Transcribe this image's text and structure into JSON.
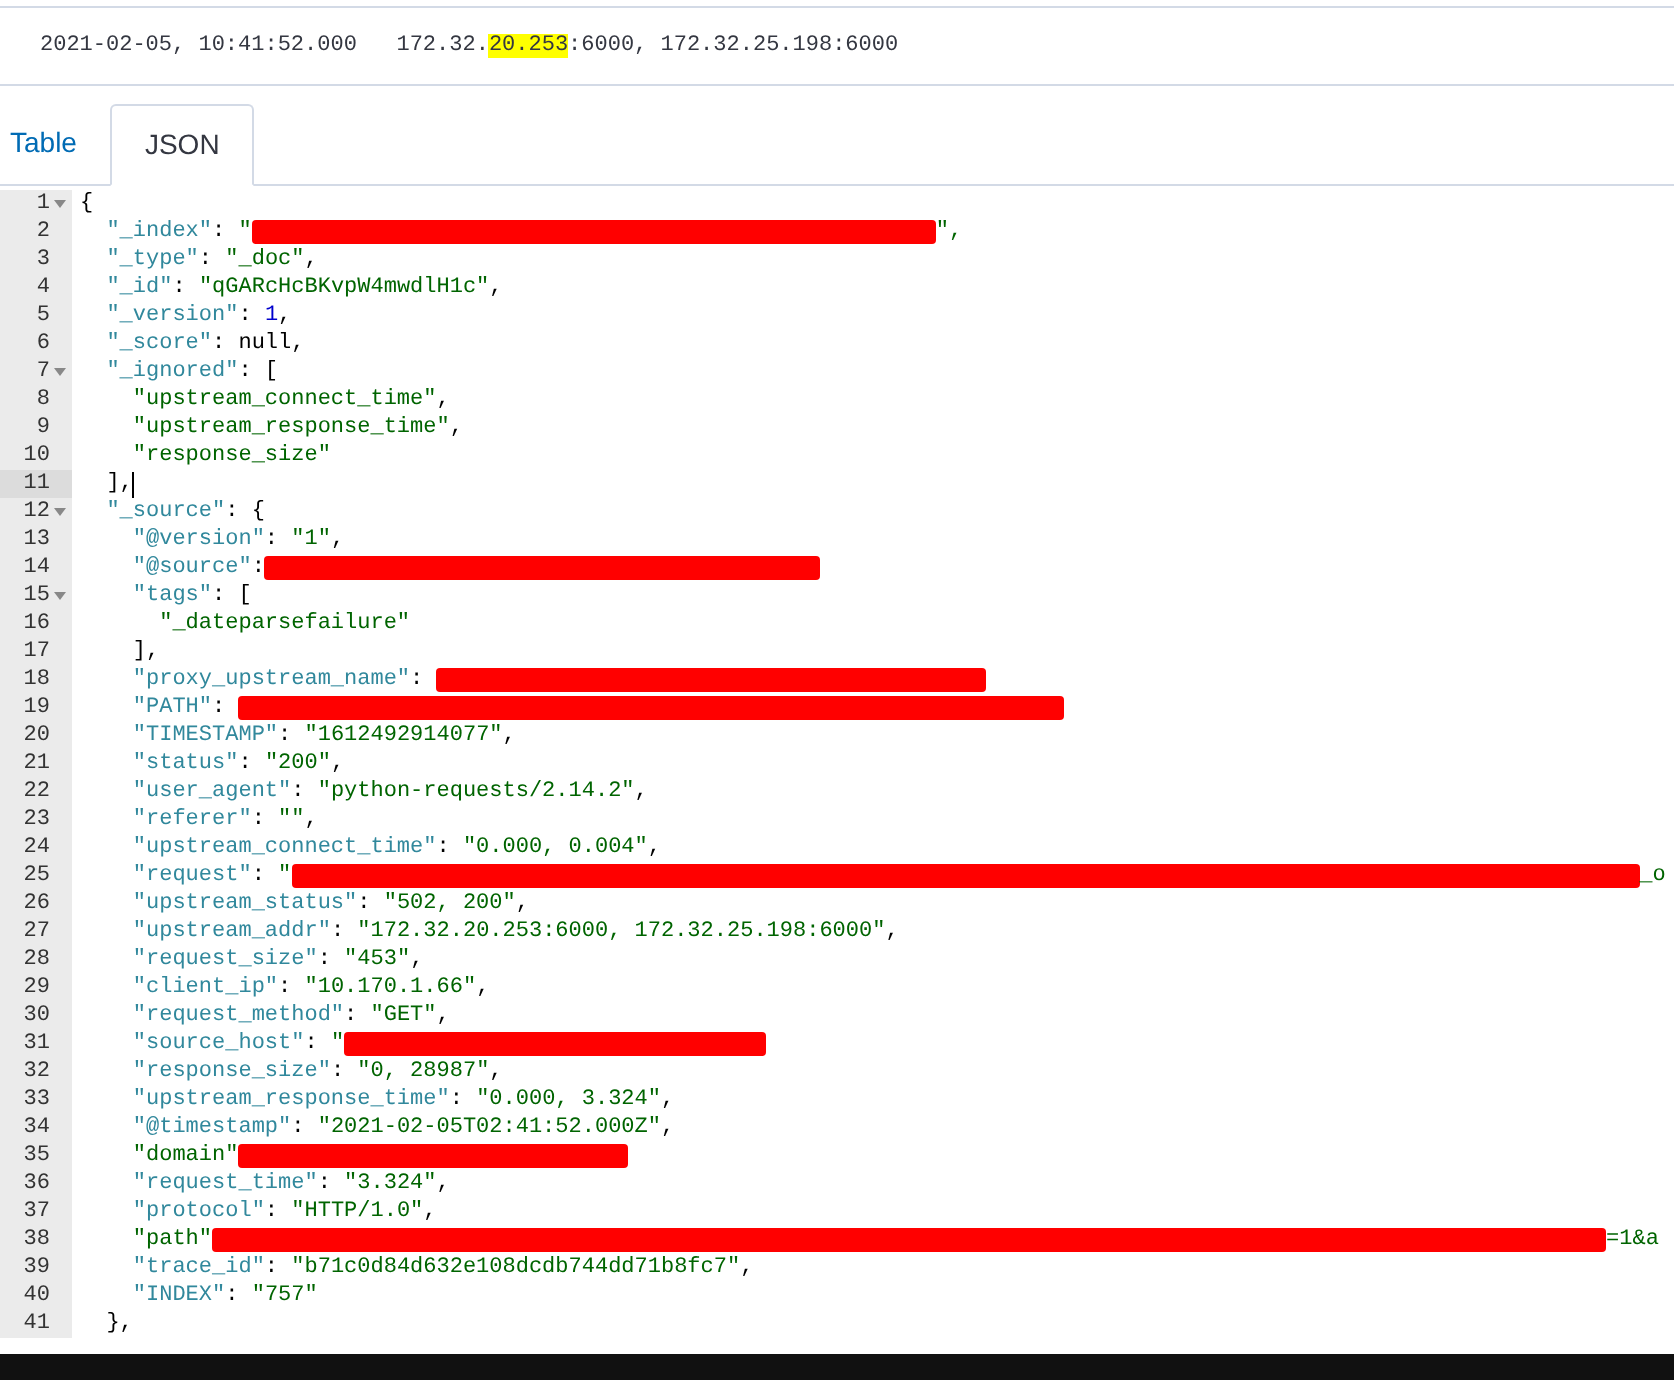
{
  "summary": {
    "timestamp": "2021-02-05, 10:41:52.000",
    "address_before": "172.32.",
    "address_highlight": "20.253",
    "address_after": ":6000, 172.32.25.198:6000"
  },
  "tabs": [
    {
      "label": "Table",
      "selected": false
    },
    {
      "label": "JSON",
      "selected": true
    }
  ],
  "editor": {
    "lines": [
      {
        "number": "1",
        "text": "{",
        "foldable": true,
        "active": false,
        "redacted": false
      },
      {
        "number": "2",
        "text": "  \"_index\": \"",
        "foldable": false,
        "active": false,
        "redacted": true,
        "tail": "\","
      },
      {
        "number": "3",
        "text": "  \"_type\": \"_doc\",",
        "foldable": false,
        "active": false,
        "redacted": false
      },
      {
        "number": "4",
        "text": "  \"_id\": \"qGARcHcBKvpW4mwdlH1c\",",
        "foldable": false,
        "active": false,
        "redacted": false
      },
      {
        "number": "5",
        "text": "  \"_version\": 1,",
        "foldable": false,
        "active": false,
        "redacted": false
      },
      {
        "number": "6",
        "text": "  \"_score\": null,",
        "foldable": false,
        "active": false,
        "redacted": false
      },
      {
        "number": "7",
        "text": "  \"_ignored\": [",
        "foldable": true,
        "active": false,
        "redacted": false
      },
      {
        "number": "8",
        "text": "    \"upstream_connect_time\",",
        "foldable": false,
        "active": false,
        "redacted": false
      },
      {
        "number": "9",
        "text": "    \"upstream_response_time\",",
        "foldable": false,
        "active": false,
        "redacted": false
      },
      {
        "number": "10",
        "text": "    \"response_size\"",
        "foldable": false,
        "active": false,
        "redacted": false
      },
      {
        "number": "11",
        "text": "  ],",
        "foldable": false,
        "active": true,
        "redacted": false
      },
      {
        "number": "12",
        "text": "  \"_source\": {",
        "foldable": true,
        "active": false,
        "redacted": false
      },
      {
        "number": "13",
        "text": "    \"@version\": \"1\",",
        "foldable": false,
        "active": false,
        "redacted": false
      },
      {
        "number": "14",
        "text": "    \"@source\":",
        "foldable": false,
        "active": false,
        "redacted": true
      },
      {
        "number": "15",
        "text": "    \"tags\": [",
        "foldable": true,
        "active": false,
        "redacted": false
      },
      {
        "number": "16",
        "text": "      \"_dateparsefailure\"",
        "foldable": false,
        "active": false,
        "redacted": false
      },
      {
        "number": "17",
        "text": "    ],",
        "foldable": false,
        "active": false,
        "redacted": false
      },
      {
        "number": "18",
        "text": "    \"proxy_upstream_name\": ",
        "foldable": false,
        "active": false,
        "redacted": true
      },
      {
        "number": "19",
        "text": "    \"PATH\": ",
        "foldable": false,
        "active": false,
        "redacted": true
      },
      {
        "number": "20",
        "text": "    \"TIMESTAMP\": \"1612492914077\",",
        "foldable": false,
        "active": false,
        "redacted": false
      },
      {
        "number": "21",
        "text": "    \"status\": \"200\",",
        "foldable": false,
        "active": false,
        "redacted": false
      },
      {
        "number": "22",
        "text": "    \"user_agent\": \"python-requests/2.14.2\",",
        "foldable": false,
        "active": false,
        "redacted": false
      },
      {
        "number": "23",
        "text": "    \"referer\": \"\",",
        "foldable": false,
        "active": false,
        "redacted": false
      },
      {
        "number": "24",
        "text": "    \"upstream_connect_time\": \"0.000, 0.004\",",
        "foldable": false,
        "active": false,
        "redacted": false
      },
      {
        "number": "25",
        "text": "    \"request\": \"",
        "foldable": false,
        "active": false,
        "redacted": true,
        "tail": "_o"
      },
      {
        "number": "26",
        "text": "    \"upstream_status\": \"502, 200\",",
        "foldable": false,
        "active": false,
        "redacted": false
      },
      {
        "number": "27",
        "text": "    \"upstream_addr\": \"172.32.20.253:6000, 172.32.25.198:6000\",",
        "foldable": false,
        "active": false,
        "redacted": false
      },
      {
        "number": "28",
        "text": "    \"request_size\": \"453\",",
        "foldable": false,
        "active": false,
        "redacted": false
      },
      {
        "number": "29",
        "text": "    \"client_ip\": \"10.170.1.66\",",
        "foldable": false,
        "active": false,
        "redacted": false
      },
      {
        "number": "30",
        "text": "    \"request_method\": \"GET\",",
        "foldable": false,
        "active": false,
        "redacted": false
      },
      {
        "number": "31",
        "text": "    \"source_host\": \"",
        "foldable": false,
        "active": false,
        "redacted": true
      },
      {
        "number": "32",
        "text": "    \"response_size\": \"0, 28987\",",
        "foldable": false,
        "active": false,
        "redacted": false
      },
      {
        "number": "33",
        "text": "    \"upstream_response_time\": \"0.000, 3.324\",",
        "foldable": false,
        "active": false,
        "redacted": false
      },
      {
        "number": "34",
        "text": "    \"@timestamp\": \"2021-02-05T02:41:52.000Z\",",
        "foldable": false,
        "active": false,
        "redacted": false
      },
      {
        "number": "35",
        "text": "    \"domain\"",
        "foldable": false,
        "active": false,
        "redacted": true
      },
      {
        "number": "36",
        "text": "    \"request_time\": \"3.324\",",
        "foldable": false,
        "active": false,
        "redacted": false
      },
      {
        "number": "37",
        "text": "    \"protocol\": \"HTTP/1.0\",",
        "foldable": false,
        "active": false,
        "redacted": false
      },
      {
        "number": "38",
        "text": "    \"path\"",
        "foldable": false,
        "active": false,
        "redacted": true,
        "tail": "=1&a"
      },
      {
        "number": "39",
        "text": "    \"trace_id\": \"b71c0d84d632e108dcdb744dd71b8fc7\",",
        "foldable": false,
        "active": false,
        "redacted": false
      },
      {
        "number": "40",
        "text": "    \"INDEX\": \"757\"",
        "foldable": false,
        "active": false,
        "redacted": false
      },
      {
        "number": "41",
        "text": "  },",
        "foldable": false,
        "active": false,
        "redacted": false
      }
    ]
  }
}
